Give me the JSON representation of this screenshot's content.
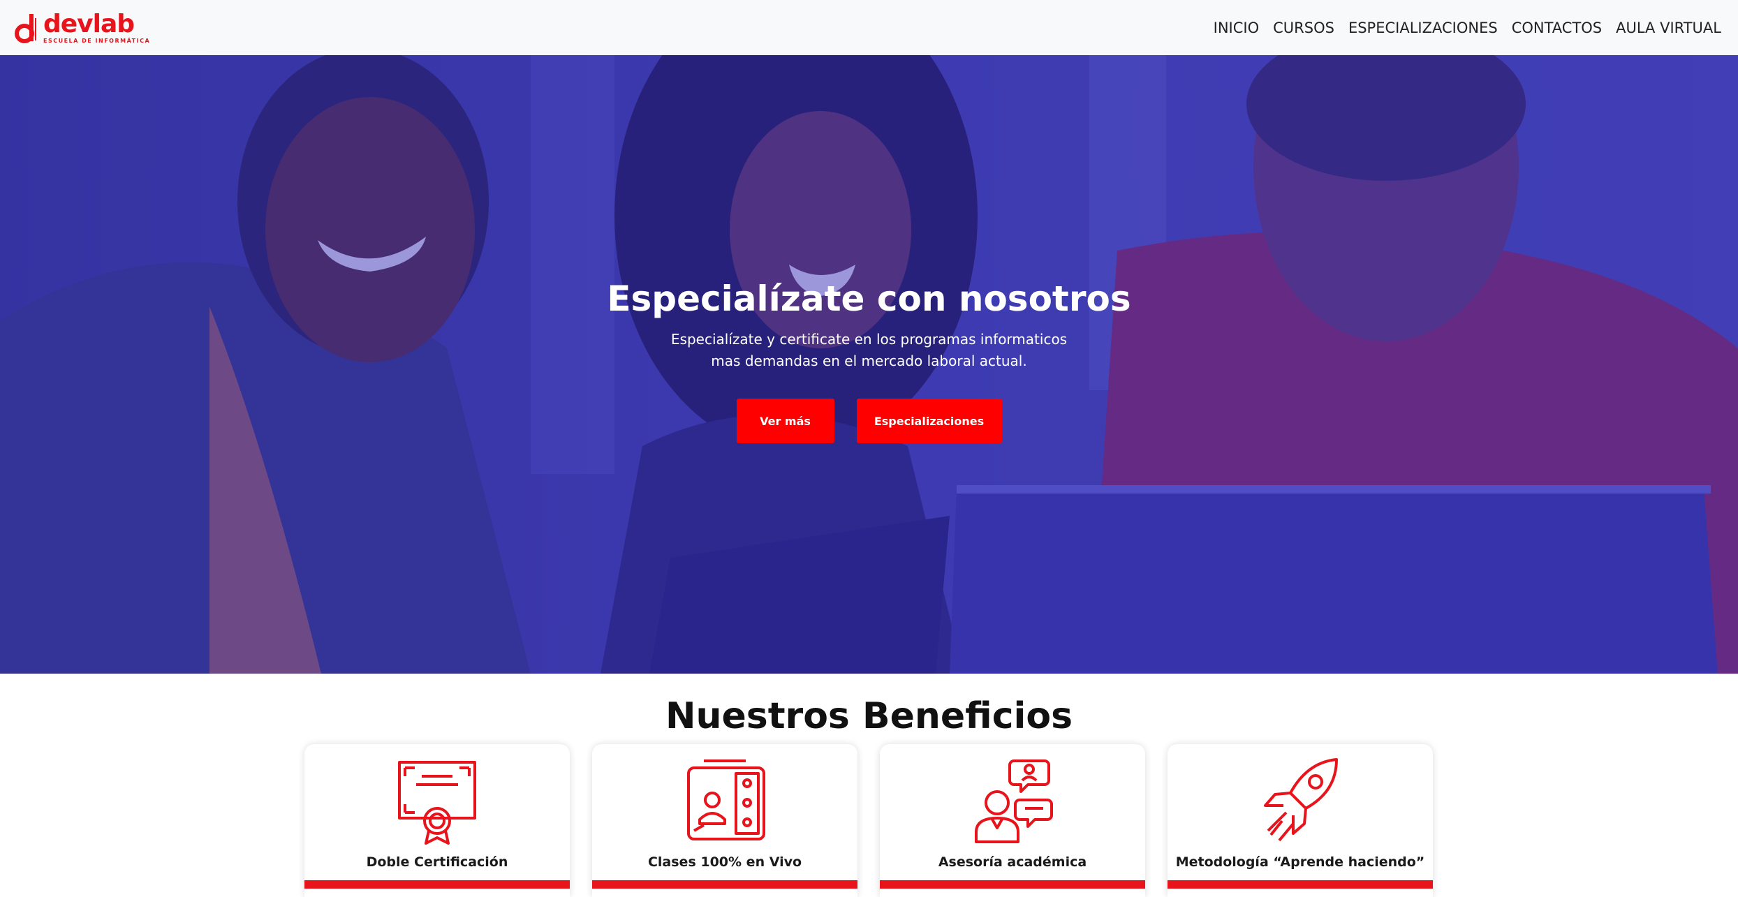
{
  "brand": {
    "name": "devlab",
    "tagline": "ESCUELA DE INFORMÁTICA",
    "accent_color": "#e8141b"
  },
  "nav": {
    "items": [
      {
        "label": "INICIO"
      },
      {
        "label": "CURSOS"
      },
      {
        "label": "ESPECIALIZACIONES"
      },
      {
        "label": "CONTACTOS"
      },
      {
        "label": "AULA VIRTUAL"
      }
    ]
  },
  "hero": {
    "title": "Especialízate con nosotros",
    "subtitle_line1": "Especialízate y certificate en los programas informaticos",
    "subtitle_line2": "mas demandas en el mercado laboral actual.",
    "button_primary": "Ver más",
    "button_secondary": "Especializaciones",
    "overlay_color": "#3b3aa6",
    "button_color": "#ff0000"
  },
  "benefits": {
    "title": "Nuestros Beneficios",
    "cards": [
      {
        "label": "Doble Certificación",
        "icon": "certificate-icon"
      },
      {
        "label": "Clases 100% en Vivo",
        "icon": "video-class-icon"
      },
      {
        "label": "Asesoría académica",
        "icon": "advisor-icon"
      },
      {
        "label": "Metodología “Aprende haciendo”",
        "icon": "rocket-icon"
      }
    ]
  }
}
